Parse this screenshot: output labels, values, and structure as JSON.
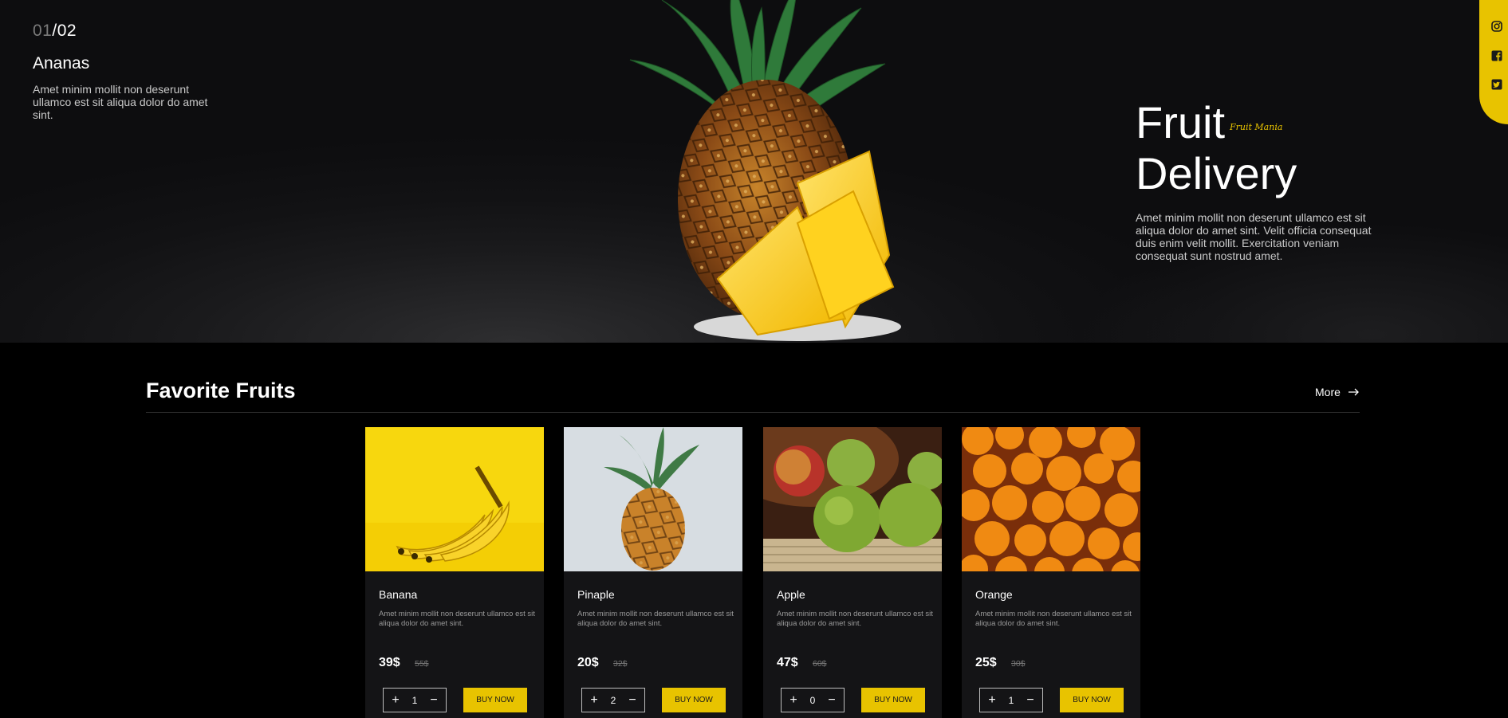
{
  "hero": {
    "counter": {
      "current": "01",
      "separator": "/",
      "total": "02"
    },
    "slide_title": "Ananas",
    "slide_description": "Amet minim mollit non deserunt ullamco est sit aliqua dolor do amet sint.",
    "headline_line1": "Fruit",
    "headline_line2": "Delivery",
    "brand": "Fruit Mania",
    "description": "Amet minim mollit non deserunt ullamco est sit aliqua dolor do amet sint. Velit officia consequat duis enim velit mollit. Exercitation veniam consequat sunt nostrud amet."
  },
  "social": {
    "icons": [
      "instagram-icon",
      "facebook-icon",
      "twitter-icon"
    ],
    "color": "#e8c300"
  },
  "section": {
    "title": "Favorite Fruits",
    "more_label": "More"
  },
  "products": [
    {
      "name": "Banana",
      "description": "Amet minim mollit non deserunt ullamco est sit aliqua dolor do amet sint.",
      "price": "39$",
      "old_price": "55$",
      "quantity": "1",
      "buy_label": "BUY NOW"
    },
    {
      "name": "Pinaple",
      "description": "Amet minim mollit non deserunt ullamco est sit aliqua dolor do amet sint.",
      "price": "20$",
      "old_price": "32$",
      "quantity": "2",
      "buy_label": "BUY NOW"
    },
    {
      "name": "Apple",
      "description": "Amet minim mollit non deserunt ullamco est sit aliqua dolor do amet sint.",
      "price": "47$",
      "old_price": "60$",
      "quantity": "0",
      "buy_label": "BUY NOW"
    },
    {
      "name": "Orange",
      "description": "Amet minim mollit non deserunt ullamco est sit aliqua dolor do amet sint.",
      "price": "25$",
      "old_price": "30$",
      "quantity": "1",
      "buy_label": "BUY NOW"
    }
  ],
  "colors": {
    "accent": "#e8c300",
    "background": "#000000",
    "card": "#141416"
  }
}
